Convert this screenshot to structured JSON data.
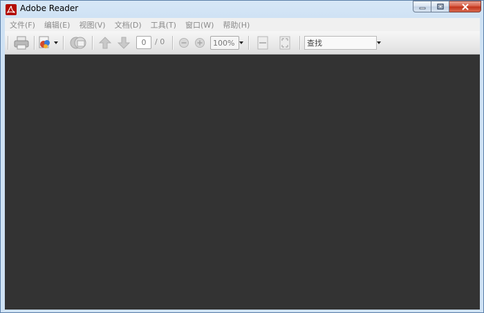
{
  "window": {
    "title": "Adobe Reader"
  },
  "menu": [
    {
      "label": "文件(F)"
    },
    {
      "label": "编辑(E)"
    },
    {
      "label": "视图(V)"
    },
    {
      "label": "文档(D)"
    },
    {
      "label": "工具(T)"
    },
    {
      "label": "窗口(W)"
    },
    {
      "label": "帮助(H)"
    }
  ],
  "toolbar": {
    "page_current": "0",
    "page_total": "/ 0",
    "zoom": "100%",
    "search_placeholder": "查找"
  },
  "icons": [
    "adobe-reader-logo-icon",
    "minimize-icon",
    "restore-icon",
    "close-icon",
    "print-icon",
    "create-pdf-icon",
    "collaborate-icon",
    "previous-page-icon",
    "next-page-icon",
    "zoom-out-icon",
    "zoom-in-icon",
    "fit-width-icon",
    "fit-page-icon"
  ]
}
